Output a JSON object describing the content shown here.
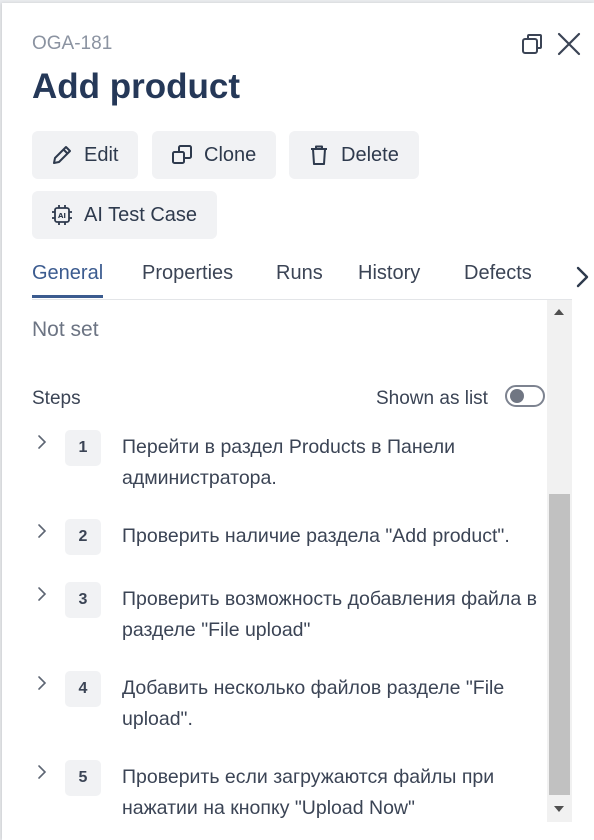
{
  "header": {
    "case_id": "OGA-181",
    "title": "Add product"
  },
  "actions": {
    "edit": "Edit",
    "clone": "Clone",
    "delete": "Delete",
    "ai_test_case": "AI Test Case"
  },
  "tabs": [
    {
      "label": "General",
      "active": true
    },
    {
      "label": "Properties"
    },
    {
      "label": "Runs"
    },
    {
      "label": "History"
    },
    {
      "label": "Defects"
    }
  ],
  "general": {
    "not_set": "Not set",
    "steps_label": "Steps",
    "shown_as_list_label": "Shown as list",
    "shown_as_list": false
  },
  "steps": [
    {
      "number": "1",
      "text": "Перейти в раздел Products в Панели администратора."
    },
    {
      "number": "2",
      "text": "Проверить наличие раздела \"Add product\"."
    },
    {
      "number": "3",
      "text": "Проверить возможность добавления файла в разделе \"File upload\""
    },
    {
      "number": "4",
      "text": "Добавить несколько файлов разделе \"File upload\"."
    },
    {
      "number": "5",
      "text": "Проверить если загружаются файлы при нажатии на кнопку \"Upload Now\""
    }
  ],
  "colors": {
    "accent": "#3b5b8f",
    "title": "#253858",
    "button_bg": "#f1f2f4"
  }
}
